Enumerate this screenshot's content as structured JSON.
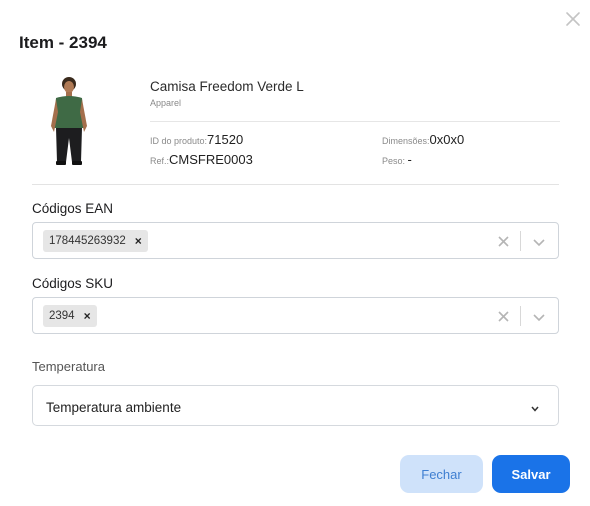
{
  "modal": {
    "title": "Item - 2394",
    "close_icon": "close-icon"
  },
  "product": {
    "image_icon": "product-photo",
    "name": "Camisa Freedom Verde L",
    "category": "Apparel",
    "id_label": "ID do produto:",
    "id_value": "71520",
    "ref_label": "Ref.:",
    "ref_value": "CMSFRE0003",
    "dim_label": "Dimensões:",
    "dim_value": "0x0x0",
    "peso_label": "Peso:",
    "peso_value": "-"
  },
  "ean": {
    "label": "Códigos EAN",
    "chips": [
      "178445263932"
    ],
    "chip_remove": "×"
  },
  "sku": {
    "label": "Códigos SKU",
    "chips": [
      "2394"
    ],
    "chip_remove": "×"
  },
  "temperatura": {
    "label": "Temperatura",
    "selected": "Temperatura ambiente"
  },
  "actions": {
    "fechar": "Fechar",
    "salvar": "Salvar"
  },
  "colors": {
    "primary": "#1a73e8",
    "secondary_bg": "#cfe2fa",
    "secondary_text": "#3f7fd1"
  }
}
